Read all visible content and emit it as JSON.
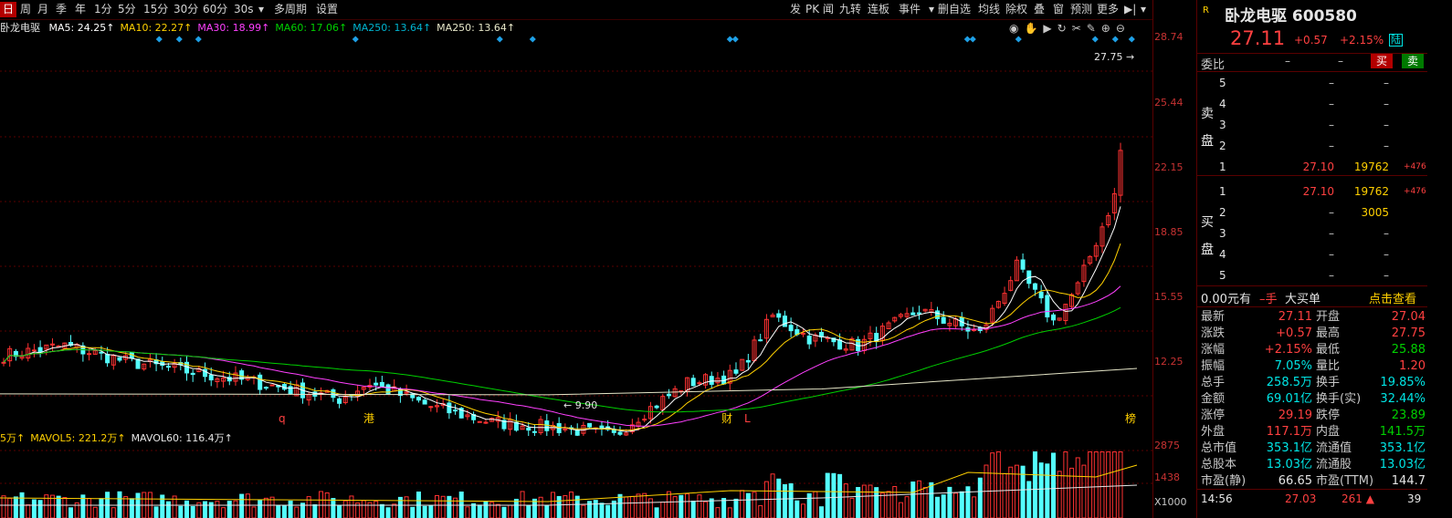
{
  "toolbar": {
    "left_items": [
      "日",
      "周",
      "月",
      "季",
      "年",
      "1分",
      "5分",
      "15分",
      "30分",
      "60分",
      "30s"
    ],
    "active_index": 0,
    "more_period": "多周期",
    "settings": "设置",
    "right_items": [
      "发",
      "PK",
      "闻",
      "九转",
      "连板",
      "事件",
      "删自选",
      "均线",
      "除权",
      "叠",
      "窗",
      "预测",
      "更多"
    ]
  },
  "ma_bar": {
    "name": "卧龙电驱",
    "items": [
      {
        "label": "MA5: 24.25↑",
        "color": "#ffffff"
      },
      {
        "label": "MA10: 22.27↑",
        "color": "#ffd000"
      },
      {
        "label": "MA30: 18.99↑",
        "color": "#ff40ff"
      },
      {
        "label": "MA60: 17.06↑",
        "color": "#00d000"
      },
      {
        "label": "MA250: 13.64↑",
        "color": "#00b4d0"
      },
      {
        "label": "MA250: 13.64↑",
        "color": "#e6e6c8"
      }
    ]
  },
  "price_axis": [
    "28.74",
    "25.44",
    "22.15",
    "18.85",
    "15.55",
    "12.25"
  ],
  "annotations": {
    "max_price": "27.75",
    "min_price": "9.90",
    "event_marks": [
      "q",
      "港",
      "财",
      "L",
      "榜"
    ]
  },
  "volume_bar": {
    "items": [
      {
        "label": "5万↑",
        "color": "#ffd000"
      },
      {
        "label": "MAVOL5: 221.2万↑",
        "color": "#ffd000"
      },
      {
        "label": "MAVOL60: 116.4万↑",
        "color": "#e6e6e6"
      }
    ]
  },
  "volume_axis": [
    "2875",
    "1438",
    "X1000"
  ],
  "panel": {
    "badge": "R",
    "title": "卧龙电驱 600580",
    "price": "27.11",
    "change": "+0.57",
    "pct": "+2.15%",
    "tag": "陆",
    "weibi_label": "委比",
    "weibi_val1": "–",
    "weibi_val2": "–",
    "buy_btn": "买",
    "sell_btn": "卖",
    "sell_label": "卖盘",
    "buy_label": "买盘",
    "sell_rows": [
      {
        "lv": "5",
        "pr": "–",
        "vo": "–",
        "ch": ""
      },
      {
        "lv": "4",
        "pr": "–",
        "vo": "–",
        "ch": ""
      },
      {
        "lv": "3",
        "pr": "–",
        "vo": "–",
        "ch": ""
      },
      {
        "lv": "2",
        "pr": "–",
        "vo": "–",
        "ch": ""
      },
      {
        "lv": "1",
        "pr": "27.10",
        "vo": "19762",
        "ch": "+476"
      }
    ],
    "buy_rows": [
      {
        "lv": "1",
        "pr": "27.10",
        "vo": "19762",
        "ch": "+476"
      },
      {
        "lv": "2",
        "pr": "–",
        "vo": "3005",
        "ch": ""
      },
      {
        "lv": "3",
        "pr": "–",
        "vo": "–",
        "ch": ""
      },
      {
        "lv": "4",
        "pr": "–",
        "vo": "–",
        "ch": ""
      },
      {
        "lv": "5",
        "pr": "–",
        "vo": "–",
        "ch": ""
      }
    ],
    "big_order": {
      "val": "0.00元有",
      "unit": "–手",
      "label": "大买单",
      "link": "点击查看"
    },
    "stats": [
      {
        "l1": "最新",
        "v1": "27.11",
        "c1": "red",
        "l2": "开盘",
        "v2": "27.04",
        "c2": "red"
      },
      {
        "l1": "涨跌",
        "v1": "+0.57",
        "c1": "red",
        "l2": "最高",
        "v2": "27.75",
        "c2": "red"
      },
      {
        "l1": "涨幅",
        "v1": "+2.15%",
        "c1": "red",
        "l2": "最低",
        "v2": "25.88",
        "c2": "green"
      },
      {
        "l1": "振幅",
        "v1": "7.05%",
        "c1": "cyan",
        "l2": "量比",
        "v2": "1.20",
        "c2": "red"
      },
      {
        "l1": "总手",
        "v1": "258.5万",
        "c1": "cyan",
        "l2": "换手",
        "v2": "19.85%",
        "c2": "cyan"
      },
      {
        "l1": "金额",
        "v1": "69.01亿",
        "c1": "cyan",
        "l2": "换手(实)",
        "v2": "32.44%",
        "c2": "cyan"
      },
      {
        "l1": "涨停",
        "v1": "29.19",
        "c1": "red",
        "l2": "跌停",
        "v2": "23.89",
        "c2": "green"
      },
      {
        "l1": "外盘",
        "v1": "117.1万",
        "c1": "red",
        "l2": "内盘",
        "v2": "141.5万",
        "c2": "green"
      },
      {
        "l1": "总市值",
        "v1": "353.1亿",
        "c1": "cyan",
        "l2": "流通值",
        "v2": "353.1亿",
        "c2": "cyan"
      },
      {
        "l1": "总股本",
        "v1": "13.03亿",
        "c1": "cyan",
        "l2": "流通股",
        "v2": "13.03亿",
        "c2": "cyan"
      },
      {
        "l1": "市盈(静)",
        "v1": "66.65",
        "c1": "white",
        "l2": "市盈(TTM)",
        "v2": "144.7",
        "c2": "white"
      }
    ],
    "tick": {
      "time": "14:56",
      "price": "27.03",
      "vol": "261",
      "extra": "39"
    }
  }
}
